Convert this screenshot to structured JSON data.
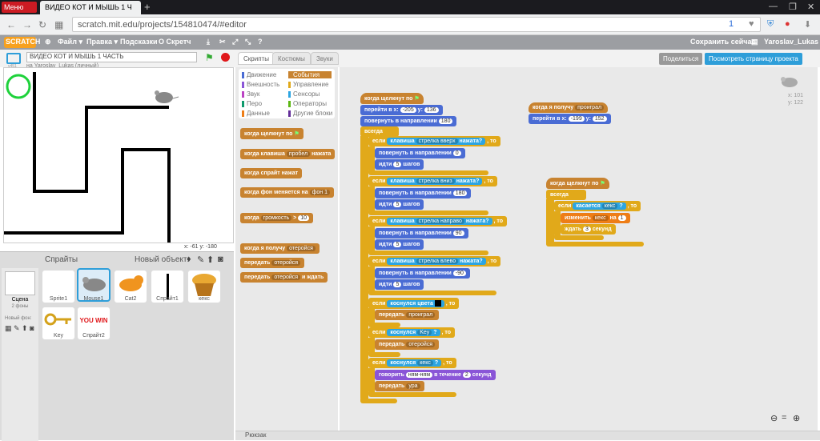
{
  "browser": {
    "menu_label": "Меню",
    "tab_title": "ВИДЕО КОТ И МЫШЬ 1 Ч",
    "url": "scratch.mit.edu/projects/154810474/#editor",
    "badge": "1"
  },
  "menu": {
    "logo": "SCRATCH",
    "items": [
      "Файл ▾",
      "Правка ▾",
      "Подсказки",
      "О Скретч"
    ],
    "save": "Сохранить сейчас",
    "user": "Yaroslav_Lukas"
  },
  "project": {
    "version": "v451",
    "title": "ВИДЕО КОТ И МЫШЬ 1 ЧАСТЬ",
    "owner": "на Yaroslav_Lukas (личный)",
    "share": "Поделиться",
    "projpage": "Посмотреть страницу проекта"
  },
  "tabs": [
    "Скрипты",
    "Костюмы",
    "Звуки"
  ],
  "stage": {
    "coords": "x: -61   y: -180"
  },
  "sprites": {
    "header": "Спрайты",
    "new": "Новый объект:",
    "scene": "Сцена",
    "scene_sub": "2 фоны",
    "new_bg": "Новый фон:",
    "items": [
      "Sprite1",
      "Mouse1",
      "Cat2",
      "Спрайт1",
      "кекс",
      "Key",
      "Спрайт2"
    ],
    "youwin": "YOU WIN"
  },
  "palette": {
    "cats_left": [
      "Движение",
      "Внешность",
      "Звук",
      "Перо",
      "Данные"
    ],
    "cats_right": [
      "События",
      "Управление",
      "Сенсоры",
      "Операторы",
      "Другие блоки"
    ],
    "colors": {
      "Движение": "#4a6cd4",
      "Внешность": "#8a55d7",
      "Звук": "#bb42c3",
      "Перо": "#0e9a6c",
      "Данные": "#ee7d16",
      "События": "#c88330",
      "Управление": "#e1a91a",
      "Сенсоры": "#2ca5e2",
      "Операторы": "#5cb712",
      "Другие блоки": "#632d99"
    },
    "blocks": [
      "когда щелкнут по",
      "когда клавиша",
      "пробел",
      "нажата",
      "когда спрайт нажат",
      "когда фон меняется на",
      "фон 1",
      "когда",
      "громкость",
      ">",
      "10",
      "когда я получу",
      "отеройся",
      "передать",
      "передать",
      "и ждать"
    ]
  },
  "scripts": {
    "main": {
      "hat": "когда щелкнут по",
      "goto": "перейти в x:",
      "gx": "-205",
      "gy": "y:",
      "gyv": "136",
      "point": "повернуть в направлении",
      "dir": "180",
      "forever": "всегда",
      "if1": {
        "if": "если",
        "key": "клавиша",
        "arg": "стрелка вверх",
        "pressed": "нажата?",
        "then": ", то",
        "point": "повернуть в направлении",
        "dir": "0",
        "move": "идти",
        "steps": "5",
        "unit": "шагов"
      },
      "if2": {
        "arg": "стрелка вниз",
        "dir": "180"
      },
      "if3": {
        "arg": "стрелка направо",
        "dir": "90"
      },
      "if4": {
        "arg": "стрелка влево",
        "dir": "-90"
      },
      "touchcolor": "коснулся цвета",
      "bcast1": "передать",
      "msg1": "проиграл",
      "touch": "коснулся",
      "key": "Key",
      "bcast2": "передать",
      "msg2": "отеройся",
      "cake": "кекс",
      "say": "говорить",
      "saytxt": "ням-ням",
      "for": "в течение",
      "secs": "2",
      "secunit": "секунд",
      "msg3": "ура"
    },
    "recv": {
      "hat": "когда я получу",
      "msg": "проиграл",
      "goto": "перейти в x:",
      "x": "-199",
      "y": "y:",
      "yv": "152"
    },
    "cake": {
      "hat": "когда щелкнут по",
      "forever": "всегда",
      "if": "если",
      "touch": "касается",
      "cat": "кекс",
      "q": "?",
      "then": ", то",
      "change": "изменить",
      "var": "кекс",
      "by": "на",
      "val": "1",
      "wait": "ждать",
      "wsec": "3",
      "wunit": "секунд"
    }
  },
  "sprite_info": {
    "x": "x: 101",
    "y": "y: 122"
  },
  "backpack": "Рюкзак"
}
